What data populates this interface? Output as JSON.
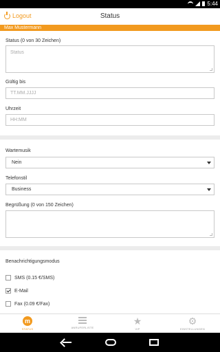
{
  "status_bar": {
    "time": "5:44"
  },
  "header": {
    "logout_label": "Logout",
    "title": "Status"
  },
  "user": {
    "name": "Max Mustermann"
  },
  "form": {
    "status_label": "Status",
    "status_hint": "(0 von 30 Zeichen)",
    "status_placeholder": "Status",
    "valid_until_label": "Gültig bis",
    "valid_until_placeholder": "TT.MM.JJJJ",
    "time_label": "Uhrzeit",
    "time_placeholder": "HH:MM",
    "hold_music_label": "Wartemusik",
    "hold_music_value": "Nein",
    "phone_style_label": "Telefonstil",
    "phone_style_value": "Business",
    "greeting_label": "Begrüßung",
    "greeting_hint": "(0 von 150 Zeichen)"
  },
  "notification": {
    "heading": "Benachrichtigungsmodus",
    "options": [
      {
        "label": "SMS (0.15 €/SMS)",
        "checked": false
      },
      {
        "label": "E-Mail",
        "checked": true
      },
      {
        "label": "Fax (0.09 €/Fax)",
        "checked": false
      }
    ]
  },
  "tabs": [
    {
      "label": "STATUS",
      "icon": "logo-m-icon",
      "active": true
    },
    {
      "label": "ANRUFERLISTE",
      "icon": "list-icon",
      "active": false
    },
    {
      "label": "VIP",
      "icon": "star-icon",
      "active": false
    },
    {
      "label": "EINSTELLUNGEN",
      "icon": "gear-icon",
      "active": false
    }
  ],
  "colors": {
    "accent": "#f29a1f",
    "background": "#ececec"
  }
}
